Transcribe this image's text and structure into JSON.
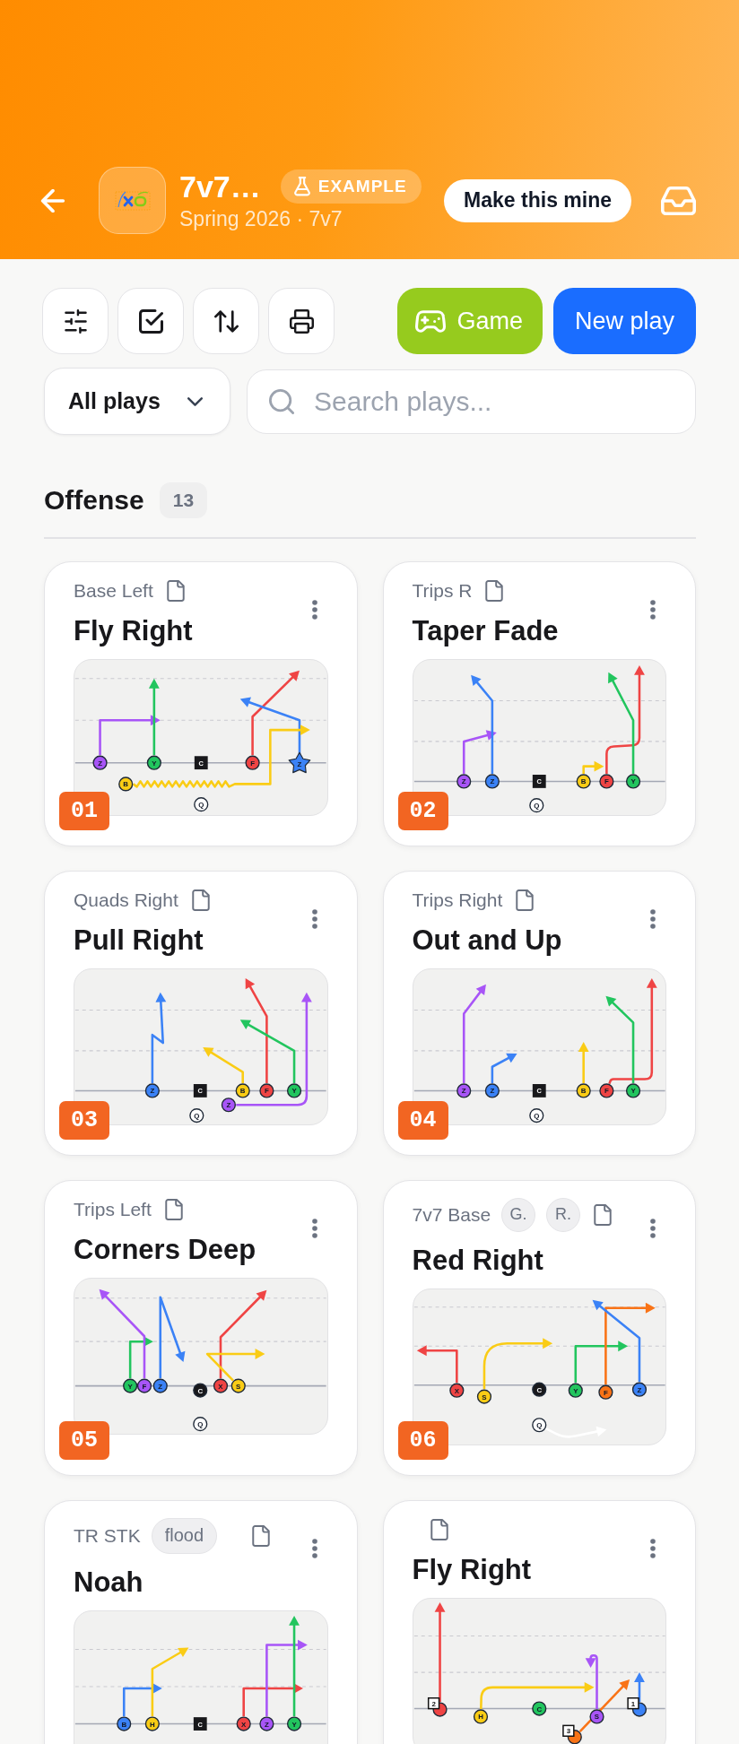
{
  "header": {
    "title": "7v7…",
    "badge": "EXAMPLE",
    "subtitle": "Spring 2026 · 7v7",
    "action": "Make this mine"
  },
  "toolbar": {
    "buttons": [
      {
        "label": "Game",
        "kind": "game"
      },
      {
        "label": "New play",
        "kind": "primary"
      }
    ]
  },
  "filter": {
    "value": "All plays"
  },
  "search": {
    "placeholder": "Search plays..."
  },
  "section": {
    "title": "Offense",
    "count": "13"
  },
  "plays": [
    {
      "formation": "Base Left",
      "title": "Fly Right",
      "number": "01",
      "diagram": {
        "players": [
          {
            "label": "Z",
            "kind": "circle",
            "color": "#a855f7"
          },
          {
            "label": "Y",
            "kind": "circle",
            "color": "#22c55e"
          },
          {
            "label": "C",
            "kind": "square",
            "color": "#18181b"
          },
          {
            "label": "F",
            "kind": "circle",
            "color": "#ef4444"
          },
          {
            "label": "Z",
            "kind": "star",
            "color": "#3b82f6"
          },
          {
            "label": "B",
            "kind": "circle",
            "color": "#facc15"
          },
          {
            "label": "Q",
            "kind": "circle",
            "color": "#ffffff"
          }
        ]
      }
    },
    {
      "formation": "Trips R",
      "title": "Taper Fade",
      "number": "02",
      "diagram": {
        "players": [
          {
            "label": "Z",
            "kind": "circle",
            "color": "#a855f7"
          },
          {
            "label": "Z",
            "kind": "circle",
            "color": "#3b82f6"
          },
          {
            "label": "C",
            "kind": "square",
            "color": "#18181b"
          },
          {
            "label": "B",
            "kind": "circle",
            "color": "#facc15"
          },
          {
            "label": "F",
            "kind": "circle",
            "color": "#ef4444"
          },
          {
            "label": "Y",
            "kind": "circle",
            "color": "#22c55e"
          },
          {
            "label": "Q",
            "kind": "circle",
            "color": "#ffffff"
          }
        ]
      }
    },
    {
      "formation": "Quads Right",
      "title": "Pull Right",
      "number": "03",
      "diagram": {
        "players": [
          {
            "label": "Z",
            "kind": "circle",
            "color": "#3b82f6"
          },
          {
            "label": "C",
            "kind": "square",
            "color": "#18181b"
          },
          {
            "label": "B",
            "kind": "circle",
            "color": "#facc15"
          },
          {
            "label": "F",
            "kind": "circle",
            "color": "#ef4444"
          },
          {
            "label": "Y",
            "kind": "circle",
            "color": "#22c55e"
          },
          {
            "label": "Z",
            "kind": "circle",
            "color": "#a855f7"
          },
          {
            "label": "Q",
            "kind": "circle",
            "color": "#ffffff"
          }
        ]
      }
    },
    {
      "formation": "Trips Right",
      "title": "Out and Up",
      "number": "04",
      "diagram": {
        "players": [
          {
            "label": "Z",
            "kind": "circle",
            "color": "#a855f7"
          },
          {
            "label": "Z",
            "kind": "circle",
            "color": "#3b82f6"
          },
          {
            "label": "C",
            "kind": "square",
            "color": "#18181b"
          },
          {
            "label": "B",
            "kind": "circle",
            "color": "#facc15"
          },
          {
            "label": "F",
            "kind": "circle",
            "color": "#ef4444"
          },
          {
            "label": "Y",
            "kind": "circle",
            "color": "#22c55e"
          },
          {
            "label": "Q",
            "kind": "circle",
            "color": "#ffffff"
          }
        ]
      }
    },
    {
      "formation": "Trips Left",
      "title": "Corners Deep",
      "number": "05",
      "diagram": {
        "players": [
          {
            "label": "Y",
            "kind": "circle",
            "color": "#22c55e"
          },
          {
            "label": "F",
            "kind": "circle",
            "color": "#a855f7"
          },
          {
            "label": "Z",
            "kind": "circle",
            "color": "#3b82f6"
          },
          {
            "label": "C",
            "kind": "circle",
            "color": "#18181b"
          },
          {
            "label": "X",
            "kind": "circle",
            "color": "#ef4444"
          },
          {
            "label": "S",
            "kind": "circle",
            "color": "#facc15"
          },
          {
            "label": "Q",
            "kind": "circle",
            "color": "#ffffff"
          }
        ]
      }
    },
    {
      "formation": "7v7 Base",
      "tags": [
        {
          "label": "G.",
          "kind": "initial"
        },
        {
          "label": "R.",
          "kind": "initial"
        }
      ],
      "title": "Red Right",
      "number": "06",
      "diagram": {
        "players": [
          {
            "label": "X",
            "kind": "circle",
            "color": "#ef4444"
          },
          {
            "label": "S",
            "kind": "circle",
            "color": "#facc15"
          },
          {
            "label": "C",
            "kind": "circle",
            "color": "#18181b"
          },
          {
            "label": "Y",
            "kind": "circle",
            "color": "#22c55e"
          },
          {
            "label": "F",
            "kind": "circle",
            "color": "#f97316"
          },
          {
            "label": "Z",
            "kind": "circle",
            "color": "#3b82f6"
          },
          {
            "label": "Q",
            "kind": "circle",
            "color": "#ffffff"
          }
        ]
      }
    },
    {
      "formation": "TR STK",
      "tags": [
        {
          "label": "flood",
          "kind": "tag"
        }
      ],
      "title": "Noah",
      "diagram": {
        "players": [
          {
            "label": "B",
            "kind": "circle",
            "color": "#3b82f6"
          },
          {
            "label": "H",
            "kind": "circle",
            "color": "#facc15"
          },
          {
            "label": "C",
            "kind": "square",
            "color": "#18181b"
          },
          {
            "label": "X",
            "kind": "circle",
            "color": "#ef4444"
          },
          {
            "label": "Z",
            "kind": "circle",
            "color": "#a855f7"
          },
          {
            "label": "Y",
            "kind": "circle",
            "color": "#22c55e"
          }
        ]
      }
    },
    {
      "title": "Fly Right",
      "diagram": {
        "players": [
          {
            "label": "2",
            "kind": "numbered",
            "color": "#ef4444"
          },
          {
            "label": "H",
            "kind": "circle",
            "color": "#facc15"
          },
          {
            "label": "C",
            "kind": "circle",
            "color": "#22c55e"
          },
          {
            "label": "S",
            "kind": "circle",
            "color": "#a855f7"
          },
          {
            "label": "1",
            "kind": "numbered",
            "color": "#3b82f6"
          },
          {
            "label": "3",
            "kind": "numbered",
            "color": "#f97316"
          }
        ]
      }
    }
  ]
}
